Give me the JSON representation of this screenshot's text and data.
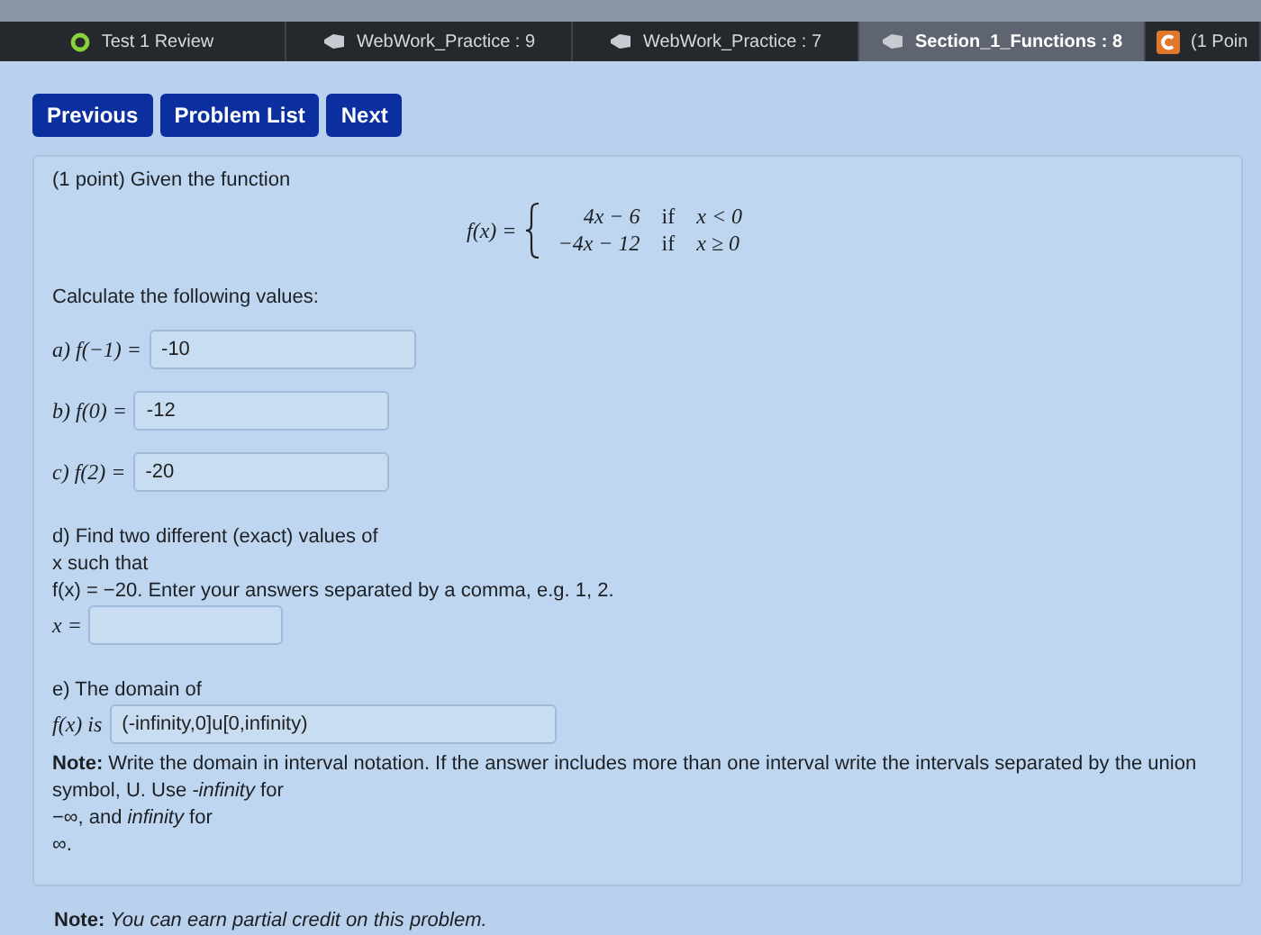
{
  "browser_tabs": [
    {
      "label": "Test 1 Review",
      "selected": false,
      "kind": "ring"
    },
    {
      "label": "WebWork_Practice : 9",
      "selected": false,
      "kind": "webwork"
    },
    {
      "label": "WebWork_Practice : 7",
      "selected": false,
      "kind": "webwork"
    },
    {
      "label": "Section_1_Functions : 8",
      "selected": true,
      "kind": "webwork"
    },
    {
      "label": "(1 Poin",
      "selected": false,
      "kind": "square"
    }
  ],
  "nav_buttons": [
    "Previous",
    "Problem List",
    "Next"
  ],
  "problem": {
    "intro": "(1 point) Given the function",
    "function": {
      "lhs": "f(x) =",
      "cases": [
        {
          "expr": "4x − 6",
          "word": "if",
          "cond": "x < 0"
        },
        {
          "expr": "−4x − 12",
          "word": "if",
          "cond": "x ≥ 0"
        }
      ]
    },
    "prompt": "Calculate the following values:",
    "parts": [
      {
        "label": "a) f(−1) =",
        "value": "-10"
      },
      {
        "label": "b) f(0) =",
        "value": "-12"
      },
      {
        "label": "c) f(2) =",
        "value": "-20"
      }
    ],
    "part_d": {
      "lines": [
        "d) Find two different (exact) values of",
        "x such that",
        "f(x) = −20. Enter your answers separated by a comma, e.g. 1, 2."
      ],
      "answer_label": "x ="
    },
    "part_e": {
      "heading": "e) The domain of",
      "answer_label": "f(x) is",
      "value": "(-infinity,0]u[0,infinity)",
      "note_lines": [
        "**Note:** Write the domain in interval notation. If the answer includes more than one interval write the intervals separated by the union",
        "symbol, U. Use *-infinity* for",
        "−∞, and *infinity* for",
        "∞."
      ]
    }
  },
  "footer_note": "**Note:** *You can earn partial credit on this problem.*"
}
